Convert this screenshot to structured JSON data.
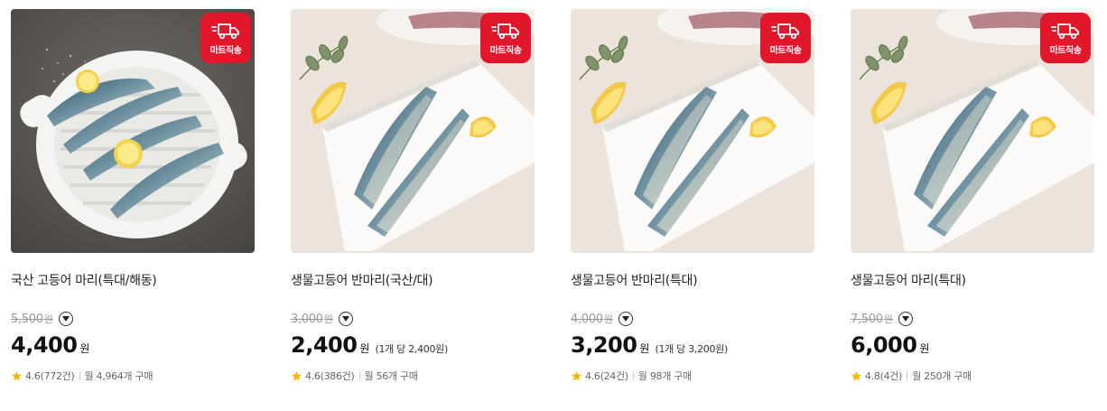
{
  "colors": {
    "badge": "#e1182b",
    "star": "#f5b800"
  },
  "badge_label": "마트직송",
  "products": [
    {
      "name": "국산 고등어 마리(특대/해동)",
      "original_price": "5,500",
      "original_unit": "원",
      "price": "4,400",
      "price_unit": "원",
      "unit_price": "",
      "rating": "4.6",
      "reviews": "(772건)",
      "monthly_sales": "월 4,964개 구매",
      "image": "mackerel-on-white-grill-plate"
    },
    {
      "name": "생물고등어 반마리(국산/대)",
      "original_price": "3,000",
      "original_unit": "원",
      "price": "2,400",
      "price_unit": "원",
      "unit_price": "(1개 당 2,400원)",
      "rating": "4.6",
      "reviews": "(386건)",
      "monthly_sales": "월 56개 구매",
      "image": "mackerel-halves-on-cutting-board"
    },
    {
      "name": "생물고등어 반마리(특대)",
      "original_price": "4,000",
      "original_unit": "원",
      "price": "3,200",
      "price_unit": "원",
      "unit_price": "(1개 당 3,200원)",
      "rating": "4.6",
      "reviews": "(24건)",
      "monthly_sales": "월 98개 구매",
      "image": "mackerel-halves-on-cutting-board"
    },
    {
      "name": "생물고등어 마리(특대)",
      "original_price": "7,500",
      "original_unit": "원",
      "price": "6,000",
      "price_unit": "원",
      "unit_price": "",
      "rating": "4.8",
      "reviews": "(4건)",
      "monthly_sales": "월 250개 구매",
      "image": "mackerel-halves-on-cutting-board"
    }
  ]
}
